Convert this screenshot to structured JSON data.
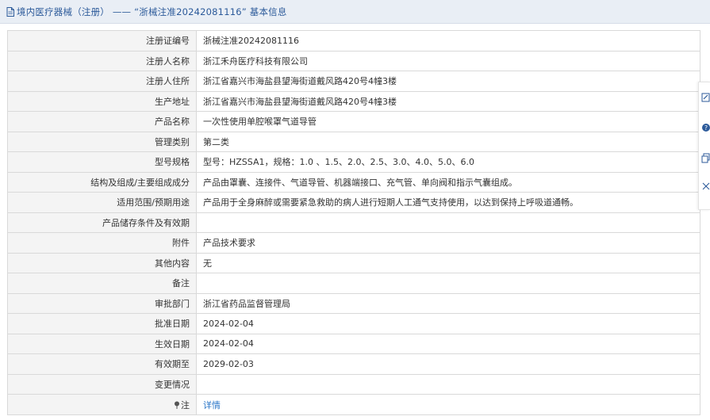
{
  "header": {
    "title": "境内医疗器械（注册） —— “浙械注准20242081116” 基本信息"
  },
  "rows": [
    {
      "label": "注册证编号",
      "value": "浙械注准20242081116"
    },
    {
      "label": "注册人名称",
      "value": "浙江禾舟医疗科技有限公司"
    },
    {
      "label": "注册人住所",
      "value": "浙江省嘉兴市海盐县望海街道戴风路420号4幢3楼"
    },
    {
      "label": "生产地址",
      "value": "浙江省嘉兴市海盐县望海街道戴风路420号4幢3楼"
    },
    {
      "label": "产品名称",
      "value": "一次性使用单腔喉罩气道导管"
    },
    {
      "label": "管理类别",
      "value": "第二类"
    },
    {
      "label": "型号规格",
      "value": "型号：HZSSA1，规格：1.0 、1.5、2.0、2.5、3.0、4.0、5.0、6.0"
    },
    {
      "label": "结构及组成/主要组成成分",
      "value": "产品由罩囊、连接件、气道导管、机器端接口、充气管、单向阀和指示气囊组成。"
    },
    {
      "label": "适用范围/预期用途",
      "value": "产品用于全身麻醉或需要紧急救助的病人进行短期人工通气支持使用，以达到保持上呼吸道通畅。"
    },
    {
      "label": "产品储存条件及有效期",
      "value": ""
    },
    {
      "label": "附件",
      "value": "产品技术要求"
    },
    {
      "label": "其他内容",
      "value": "无"
    },
    {
      "label": "备注",
      "value": ""
    },
    {
      "label": "审批部门",
      "value": "浙江省药品监督管理局"
    },
    {
      "label": "批准日期",
      "value": "2024-02-04"
    },
    {
      "label": "生效日期",
      "value": "2024-02-04"
    },
    {
      "label": "有效期至",
      "value": "2029-02-03"
    },
    {
      "label": "变更情况",
      "value": ""
    }
  ],
  "note": {
    "label": "注",
    "link_text": "详情"
  },
  "colors": {
    "title": "#2c5a9a",
    "link": "#2a76c8",
    "label_bg": "#f4f4f4",
    "border": "#d9d9d9",
    "header_bg": "#e9eef5"
  },
  "icons": {
    "header": "document-icon",
    "note": "pin-icon",
    "toolbar": [
      "edit-icon",
      "help-icon",
      "copy-icon",
      "close-icon"
    ]
  }
}
